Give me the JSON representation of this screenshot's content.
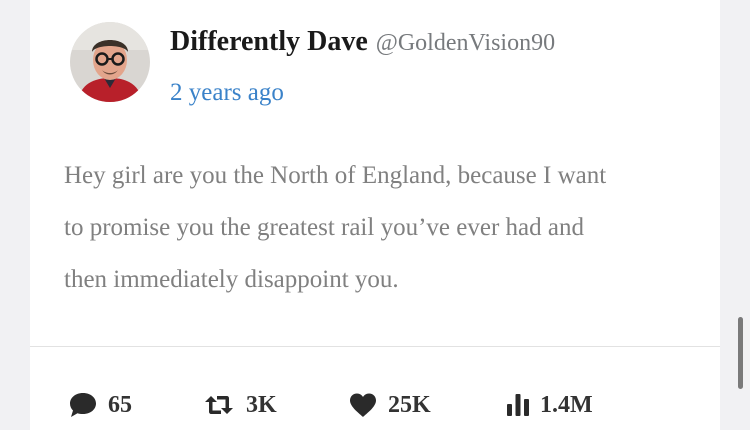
{
  "tweet": {
    "author": {
      "display_name": "Differently Dave",
      "handle": "@GoldenVision90"
    },
    "timestamp": "2 years ago",
    "text_lines": [
      "Hey girl are you the North of England, because I want",
      "to promise you the greatest rail you’ve ever had and",
      "then immediately disappoint you."
    ],
    "stats": {
      "replies": "65",
      "retweets": "3K",
      "likes": "25K",
      "views": "1.4M"
    }
  },
  "icons": {
    "replies": "speech-bubble-icon",
    "retweets": "retweet-icon",
    "likes": "heart-icon",
    "views": "bar-chart-icon"
  },
  "colors": {
    "link": "#3a82c9",
    "body_text": "#808080",
    "name_text": "#1a1a1a",
    "handle_text": "#777a7d",
    "page_background": "#f1f1f3",
    "card_background": "#ffffff"
  }
}
